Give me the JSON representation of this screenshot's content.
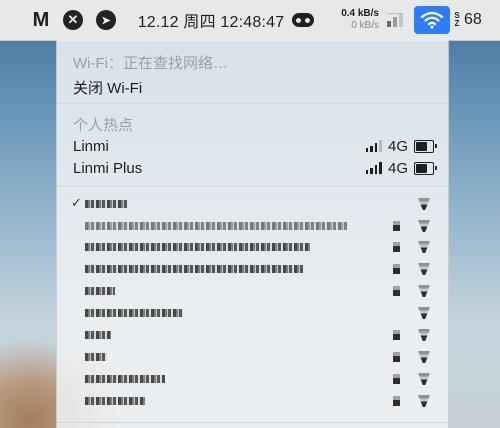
{
  "menubar": {
    "date_time": "12.12 周四 12:48:47",
    "net_up": "0.4 kB/s",
    "net_down": "0 kB/s",
    "trail_text": "68",
    "vert_text": "S\nZ"
  },
  "wifi_menu": {
    "status": "Wi-Fi：正在查找网络…",
    "toggle_label": "关闭 Wi-Fi",
    "hotspot_header": "个人热点",
    "hotspots": [
      {
        "name": "Linmi",
        "type": "4G",
        "signal": 3
      },
      {
        "name": "Linmi Plus",
        "type": "4G",
        "signal": 4
      }
    ],
    "networks_count_visible": 10
  },
  "colors": {
    "menubar_bg": "#e7e8ea",
    "wifi_active_bg": "#2f7cf6",
    "text": "#1e1e1e",
    "muted": "#9b9fa4"
  }
}
